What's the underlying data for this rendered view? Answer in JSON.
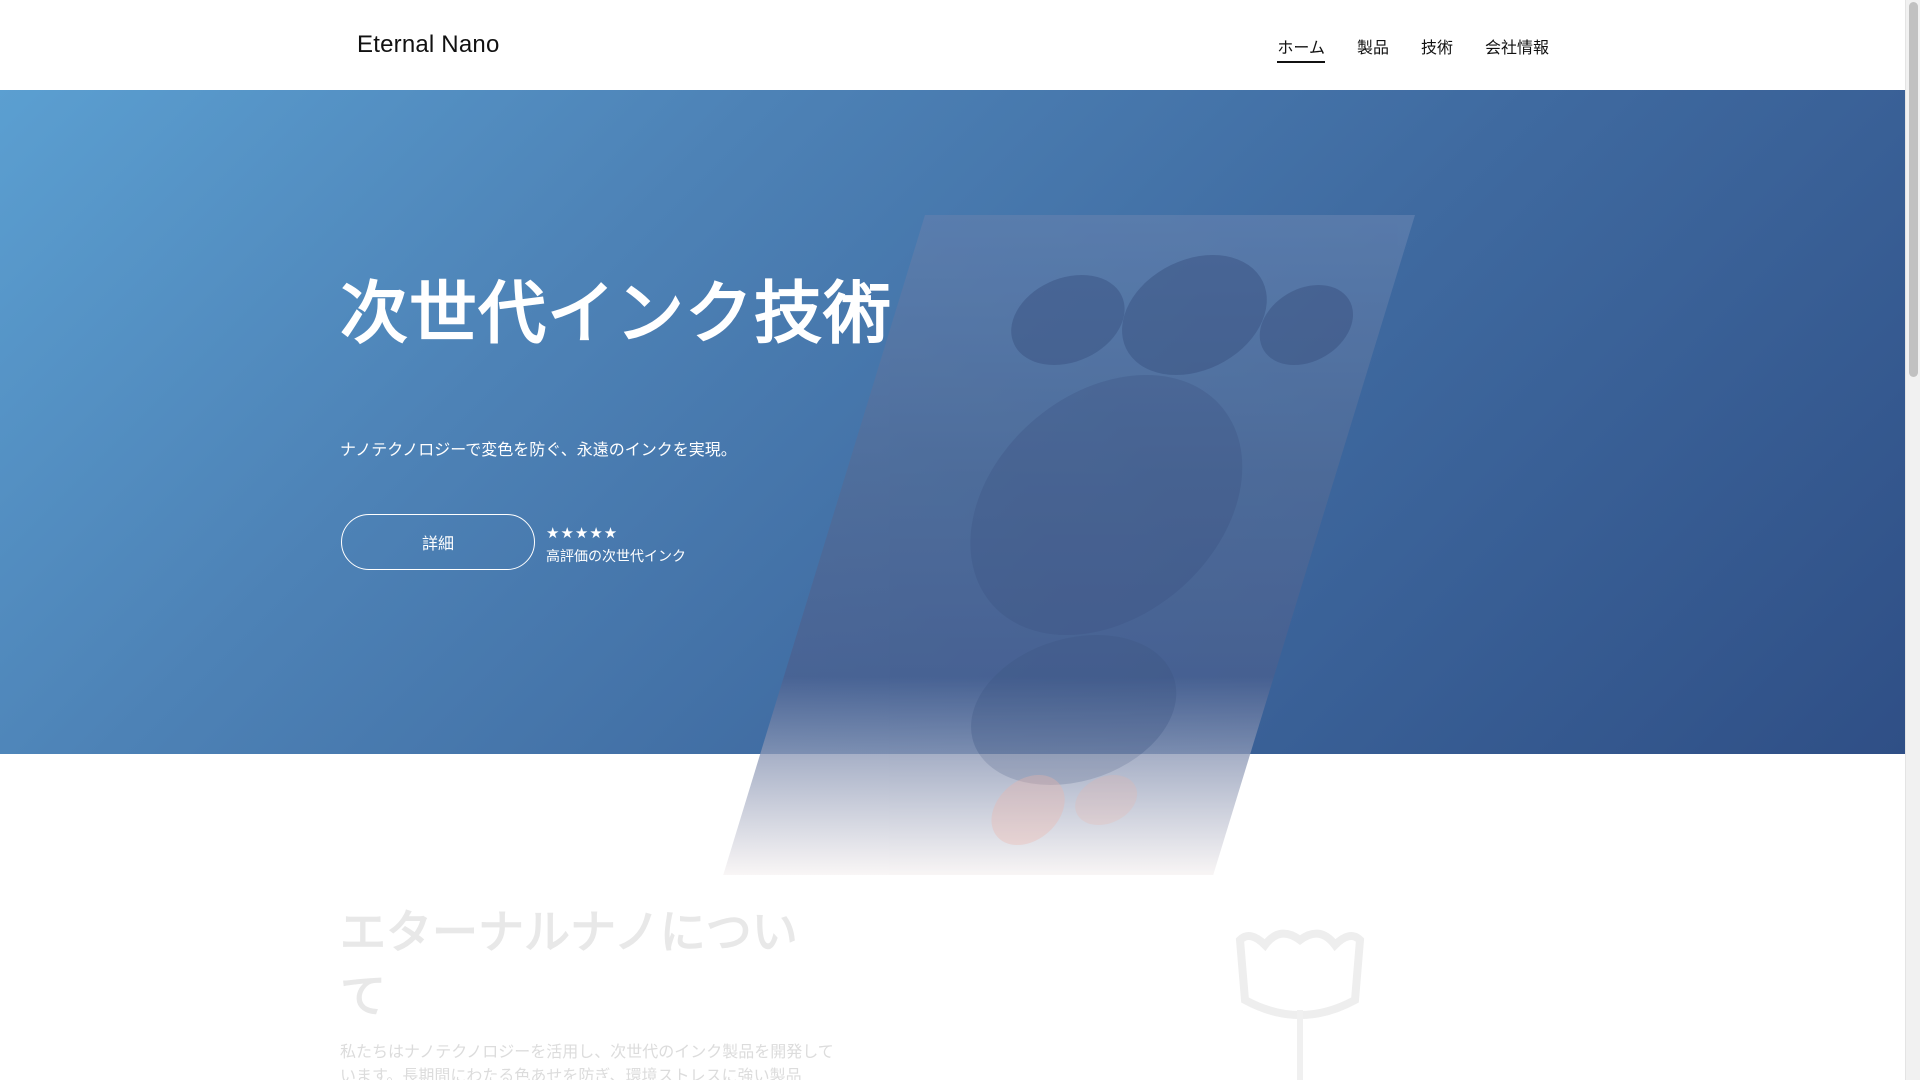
{
  "header": {
    "logo": "Eternal Nano",
    "nav": [
      {
        "label": "ホーム",
        "active": true
      },
      {
        "label": "製品",
        "active": false
      },
      {
        "label": "技術",
        "active": false
      },
      {
        "label": "会社情報",
        "active": false
      }
    ]
  },
  "hero": {
    "title": "次世代インク技術",
    "subtitle": "ナノテクノロジーで変色を防ぐ、永遠のインクを実現。",
    "cta_label": "詳細",
    "rating_stars": "★★★★★",
    "rating_label": "高評価の次世代インク",
    "background_colors": [
      "#5b9fd1",
      "#2f4f86"
    ]
  },
  "about": {
    "title": "エターナルナノについて",
    "body": "私たちはナノテクノロジーを活用し、次世代のインク製品を開発しています。長期間にわたる色あせを防ぎ、環境ストレスに強い製品"
  }
}
